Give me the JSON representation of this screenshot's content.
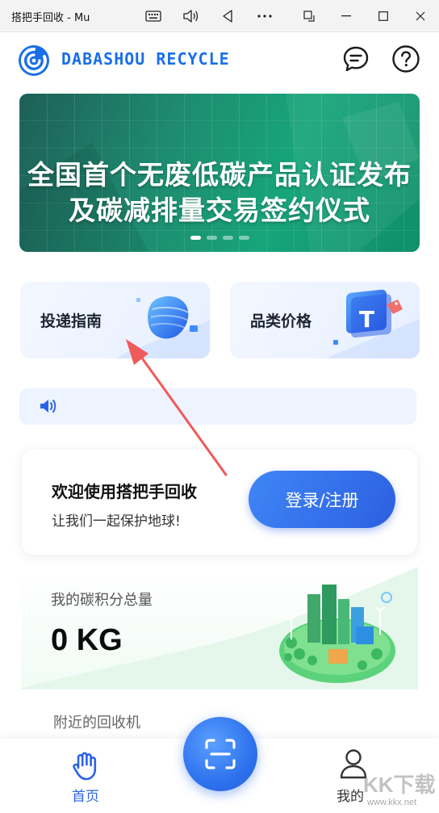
{
  "window": {
    "title": "搭把手回收 - Mu",
    "controls": [
      "keyboard-icon",
      "volume-icon",
      "back-triangle-icon",
      "more-icon",
      "snap-icon",
      "minimize-icon",
      "maximize-icon",
      "close-icon"
    ]
  },
  "header": {
    "brand": "DABASHOU RECYCLE",
    "brand_color": "#1a6fe8",
    "message_icon": "message-icon",
    "help_icon": "help-icon"
  },
  "banner": {
    "line1": "全国首个无废低碳产品认证发布",
    "line2": "及碳减排量交易签约仪式",
    "dots": 4,
    "active_dot": 0
  },
  "cards": [
    {
      "label": "投递指南",
      "icon": "delivery-guide-icon"
    },
    {
      "label": "品类价格",
      "icon": "category-price-icon"
    }
  ],
  "notice": {
    "icon": "speaker-icon"
  },
  "welcome": {
    "title": "欢迎使用搭把手回收",
    "subtitle": "让我们一起保护地球!",
    "login_label": "登录/注册"
  },
  "carbon": {
    "label": "我的碳积分总量",
    "value": "0 KG"
  },
  "nearby": {
    "label": "附近的回收机"
  },
  "bottom_nav": {
    "home_label": "首页",
    "mine_label": "我的",
    "accent": "#2b63e8"
  },
  "watermark": {
    "text": "KK下载",
    "url": "www.kkx.net"
  }
}
